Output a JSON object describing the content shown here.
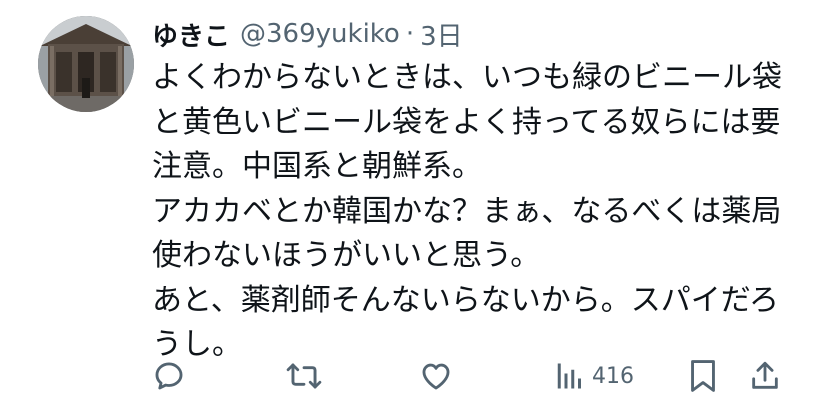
{
  "tweet": {
    "display_name": "ゆきこ",
    "handle": "@369yukiko",
    "separator": "·",
    "timestamp": "3日",
    "text_lines": [
      "よくわからないときは、いつも緑のビニール袋",
      "と黄色いビニール袋をよく持ってる奴らには要",
      "注意。中国系と朝鮮系。",
      "アカカベとか韓国かな？まぁ、なるべくは薬局",
      "使わないほうがいいと思う。",
      "あと、薬剤師そんないらないから。スパイだろ",
      "うし。"
    ]
  },
  "actions": {
    "reply_icon": "reply-icon",
    "retweet_icon": "retweet-icon",
    "like_icon": "heart-icon",
    "views_icon": "views-chart-icon",
    "views_count": "416",
    "bookmark_icon": "bookmark-icon",
    "share_icon": "share-icon"
  },
  "colors": {
    "text": "#0f1419",
    "secondary_text": "#536471",
    "background": "#ffffff"
  }
}
